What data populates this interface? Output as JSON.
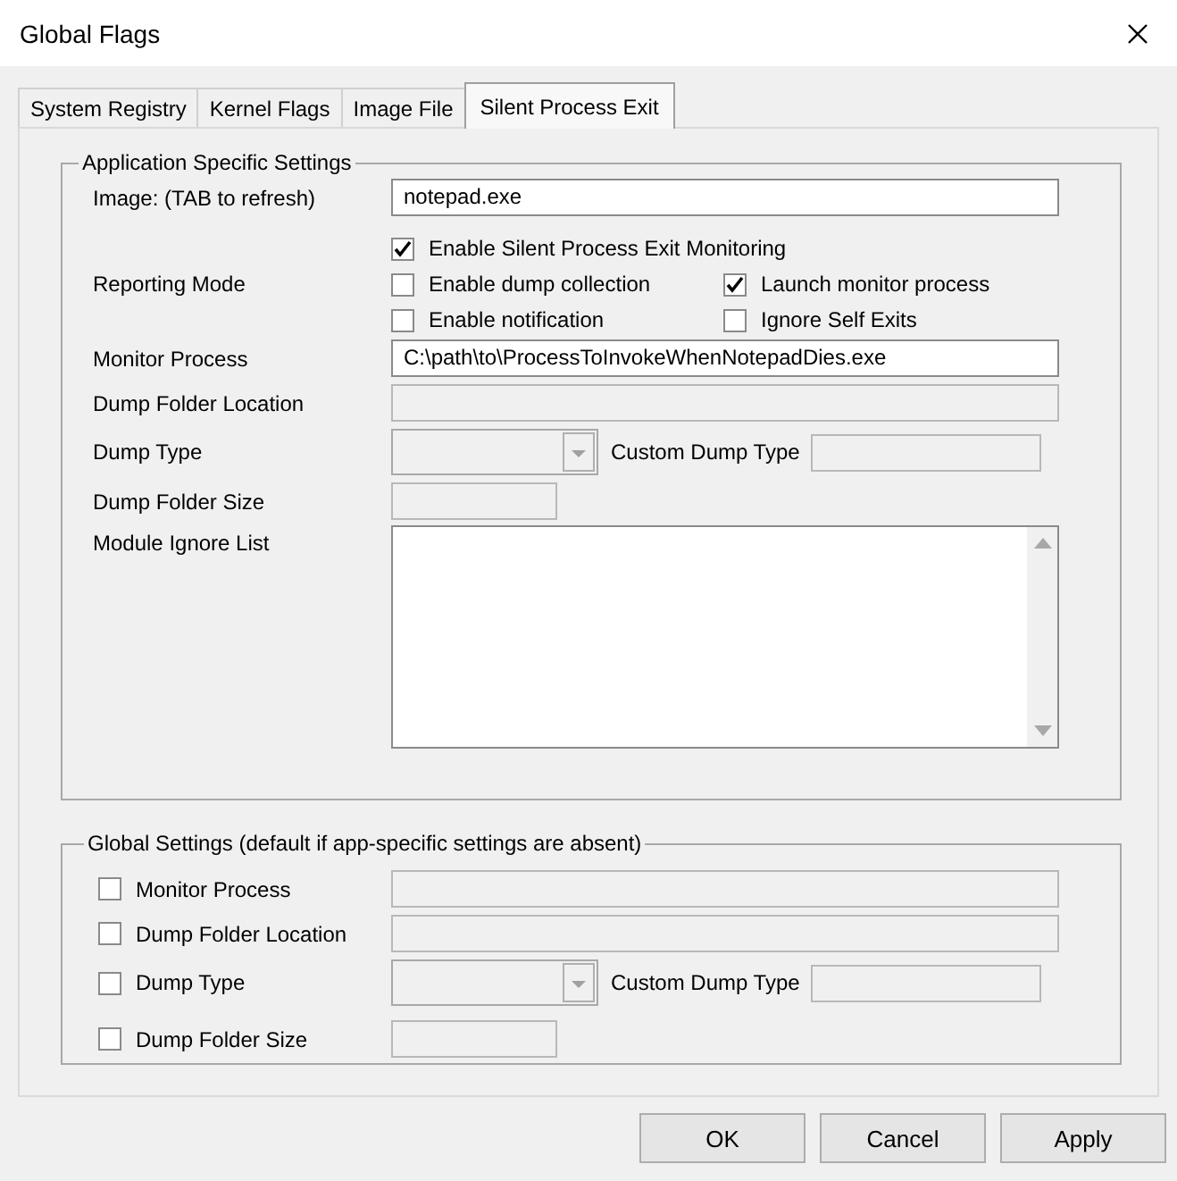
{
  "window": {
    "title": "Global Flags"
  },
  "tabs": [
    {
      "label": "System Registry",
      "selected": false
    },
    {
      "label": "Kernel Flags",
      "selected": false
    },
    {
      "label": "Image File",
      "selected": false
    },
    {
      "label": "Silent Process Exit",
      "selected": true
    }
  ],
  "app_settings": {
    "title": "Application Specific Settings",
    "image": {
      "label": "Image:  (TAB to refresh)",
      "value": "notepad.exe",
      "disabled": false
    },
    "reporting_mode": {
      "label": "Reporting Mode",
      "options": [
        {
          "label": "Enable Silent Process Exit Monitoring",
          "checked": true
        },
        {
          "label": "Enable dump collection",
          "checked": false
        },
        {
          "label": "Launch monitor process",
          "checked": true
        },
        {
          "label": "Enable notification",
          "checked": false
        },
        {
          "label": "Ignore Self Exits",
          "checked": false
        }
      ]
    },
    "monitor_process": {
      "label": "Monitor Process",
      "value": "C:\\path\\to\\ProcessToInvokeWhenNotepadDies.exe",
      "disabled": false
    },
    "dump_folder_location": {
      "label": "Dump Folder Location",
      "disabled": true
    },
    "dump_type": {
      "label": "Dump Type",
      "disabled": true
    },
    "custom_dump_type": {
      "label": "Custom Dump Type",
      "disabled": true
    },
    "dump_folder_size": {
      "label": "Dump Folder Size",
      "disabled": true
    },
    "module_ignore_list": {
      "label": "Module Ignore List",
      "disabled": false
    }
  },
  "global_settings": {
    "title": "Global Settings (default if app-specific settings are absent)",
    "rows": [
      {
        "kind": "text",
        "label": "Monitor Process",
        "checked": false,
        "disabled": true
      },
      {
        "kind": "text",
        "label": "Dump Folder Location",
        "checked": false,
        "disabled": true
      },
      {
        "kind": "combo",
        "label": "Dump Type",
        "checked": false,
        "disabled": true,
        "custom_label": "Custom Dump Type"
      },
      {
        "kind": "short",
        "label": "Dump Folder Size",
        "checked": false,
        "disabled": true
      }
    ]
  },
  "buttons": [
    {
      "label": "OK"
    },
    {
      "label": "Cancel"
    },
    {
      "label": "Apply"
    }
  ]
}
